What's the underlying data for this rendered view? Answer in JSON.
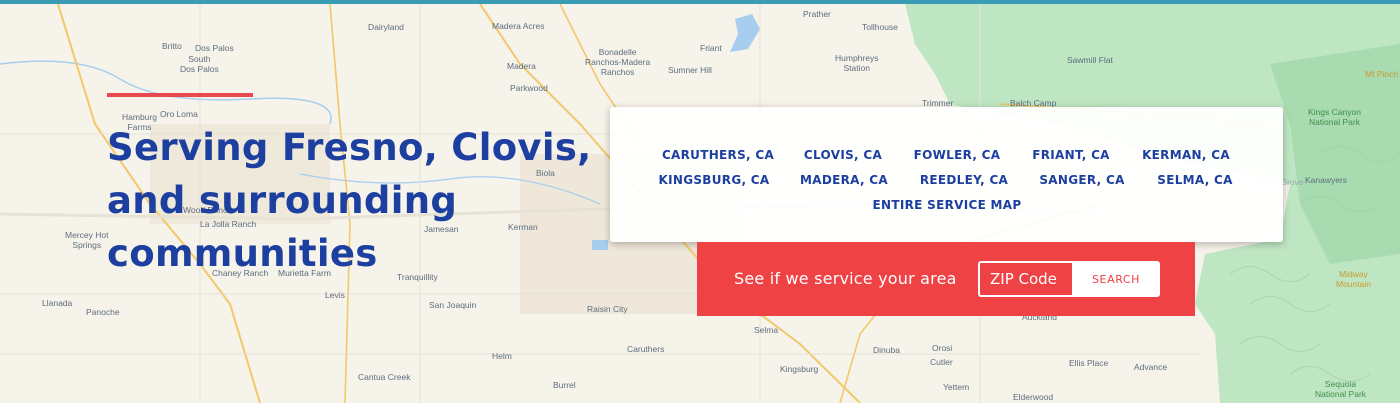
{
  "colors": {
    "accent_red": "#ee4245",
    "headline_blue": "#1c3fa0",
    "top_line": "#3a9bb5",
    "park_green": "#bfe6c3"
  },
  "map": {
    "labels": {
      "dairyland": "Dairyland",
      "madera_acres": "Madera Acres",
      "prather": "Prather",
      "tollhouse": "Tollhouse",
      "britto": "Britto",
      "dos_palos": "Dos Palos",
      "south_dos_palos": "South\nDos Palos",
      "madera": "Madera",
      "bonadelle": "Bonadelle\nRanchos-Madera\nRanchos",
      "friant": "Friant",
      "sumner_hill": "Sumner Hill",
      "humphreys_station": "Humphreys\nStation",
      "sawmill_flat": "Sawmill Flat",
      "mt_pinchot": "Mt Pinch",
      "parkwood": "Parkwood",
      "hamburg_farms": "Hamburg\nFarms",
      "oro_loma": "Oro Loma",
      "trimmer": "Trimmer",
      "balch_camp": "Balch Camp",
      "kings_canyon": "Kings Canyon\nNational Park",
      "biola": "Biola",
      "cedar_grove": "Cedar Grove",
      "kanawyers": "Kanawyers",
      "wood_ranch": "Wood Ranch",
      "la_jolla_ranch": "La Jolla Ranch",
      "jamesan": "Jamesan",
      "kerman": "Kerman",
      "mercey_hot_springs": "Mercey Hot\nSprings",
      "chaney_ranch": "Chaney Ranch",
      "murietta_farm": "Murietta Farm",
      "tranquillity": "Tranquillity",
      "levis": "Levis",
      "llanada": "Llanada",
      "panoche": "Panoche",
      "san_joaquin": "San Joaquin",
      "raisin_city": "Raisin City",
      "selma": "Selma",
      "auckland": "Auckland",
      "caruthers": "Caruthers",
      "helm": "Helm",
      "dinuba": "Dinuba",
      "orosi": "Orosi",
      "cutler": "Cutler",
      "ellis_place": "Ellis Place",
      "advance": "Advance",
      "midway_mountain": "Midway\nMountain",
      "cantua_creek": "Cantua Creek",
      "burrel": "Burrel",
      "kingsburg": "Kingsburg",
      "yettem": "Yettem",
      "elderwood": "Elderwood",
      "sequoia": "Sequoia\nNational Park"
    }
  },
  "hero": {
    "headline_lines": [
      "Serving Fresno, Clovis,",
      "and surrounding",
      "communities"
    ]
  },
  "service_areas": {
    "cities": [
      "CARUTHERS, CA",
      "CLOVIS, CA",
      "FOWLER, CA",
      "FRIANT, CA",
      "KERMAN, CA",
      "KINGSBURG, CA",
      "MADERA, CA",
      "REEDLEY, CA",
      "SANGER, CA",
      "SELMA, CA"
    ],
    "map_link": "ENTIRE SERVICE MAP"
  },
  "zip_check": {
    "prompt": "See if we service your area",
    "placeholder": "ZIP Code",
    "button_label": "SEARCH"
  }
}
